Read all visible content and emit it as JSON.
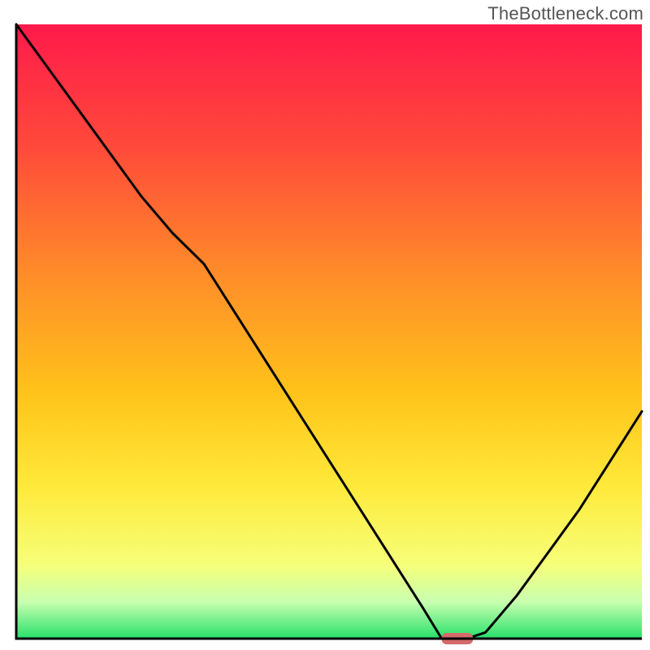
{
  "watermark": "TheBottleneck.com",
  "chart_data": {
    "type": "line",
    "title": "",
    "xlabel": "",
    "ylabel": "",
    "xlim": [
      0,
      100
    ],
    "ylim": [
      0,
      100
    ],
    "x": [
      0,
      5,
      10,
      15,
      20,
      25,
      30,
      35,
      40,
      45,
      50,
      55,
      60,
      65,
      68,
      72,
      75,
      80,
      85,
      90,
      95,
      100
    ],
    "values": [
      100,
      93,
      86,
      79,
      72,
      66,
      61,
      53,
      45,
      37,
      29,
      21,
      13,
      5,
      0,
      0,
      1,
      7,
      14,
      21,
      29,
      37
    ],
    "minimum_band": {
      "x_start": 68,
      "x_end": 73,
      "y": 0
    },
    "background": {
      "type": "vertical-gradient",
      "stops": [
        {
          "offset": 0.0,
          "color": "#ff1a4b"
        },
        {
          "offset": 0.2,
          "color": "#ff4a3a"
        },
        {
          "offset": 0.4,
          "color": "#ff8a2a"
        },
        {
          "offset": 0.6,
          "color": "#ffc31a"
        },
        {
          "offset": 0.75,
          "color": "#ffe93a"
        },
        {
          "offset": 0.88,
          "color": "#f6ff7a"
        },
        {
          "offset": 0.94,
          "color": "#c9ffb0"
        },
        {
          "offset": 1.0,
          "color": "#27e06a"
        }
      ]
    },
    "axes": {
      "stroke": "#000000",
      "stroke_width": 3
    },
    "marker": {
      "fill": "#d46a6a",
      "rx": 6
    }
  }
}
